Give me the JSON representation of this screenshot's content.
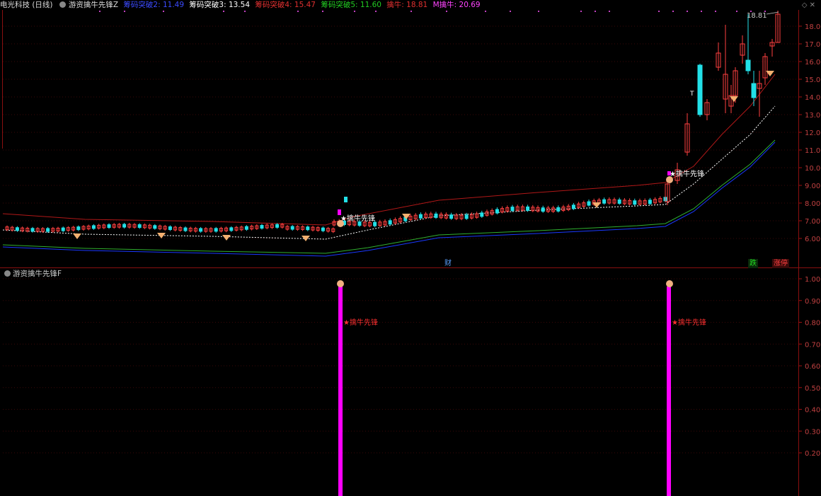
{
  "header": {
    "stock": "电光科技 (日线)",
    "indicator": "游资擒牛先锋Z",
    "items": [
      {
        "label": "筹码突破2: 11.49",
        "color": "#3b4bff"
      },
      {
        "label": "筹码突破3: 13.54",
        "color": "#ffffff"
      },
      {
        "label": "筹码突破4: 15.47",
        "color": "#e03030"
      },
      {
        "label": "筹码突破5: 11.60",
        "color": "#22cc22"
      },
      {
        "label": "擒牛: 18.81",
        "color": "#e03030"
      },
      {
        "label": "M擒牛: 20.69",
        "color": "#ff44ff"
      }
    ]
  },
  "sub_header": {
    "indicator": "游资擒牛先锋F"
  },
  "main_panel": {
    "price_ticks": [
      "18.00",
      "17.00",
      "16.00",
      "15.00",
      "14.00",
      "13.00",
      "12.00",
      "11.00",
      "10.00",
      "9.00",
      "8.00",
      "7.00",
      "6.00"
    ],
    "high_label": "18.81",
    "signal_label": "★擒牛先锋",
    "caitag": "财",
    "die_tag": "跌",
    "zhangting_tag": "涨停",
    "t_marker": "T"
  },
  "sub_panel": {
    "ticks": [
      "1.00",
      "0.90",
      "0.80",
      "0.70",
      "0.60",
      "0.50",
      "0.40",
      "0.30",
      "0.20"
    ],
    "signal_label": "★擒牛先锋"
  },
  "colors": {
    "up": "#ff4040",
    "down": "#22e0e8",
    "ma_upper": "#b01818",
    "ma_mid": "#ffffff",
    "ma_green": "#2fae2f",
    "ma_blue": "#1a38ff",
    "signal": "#ff00ff",
    "grid": "#5a1010"
  }
}
